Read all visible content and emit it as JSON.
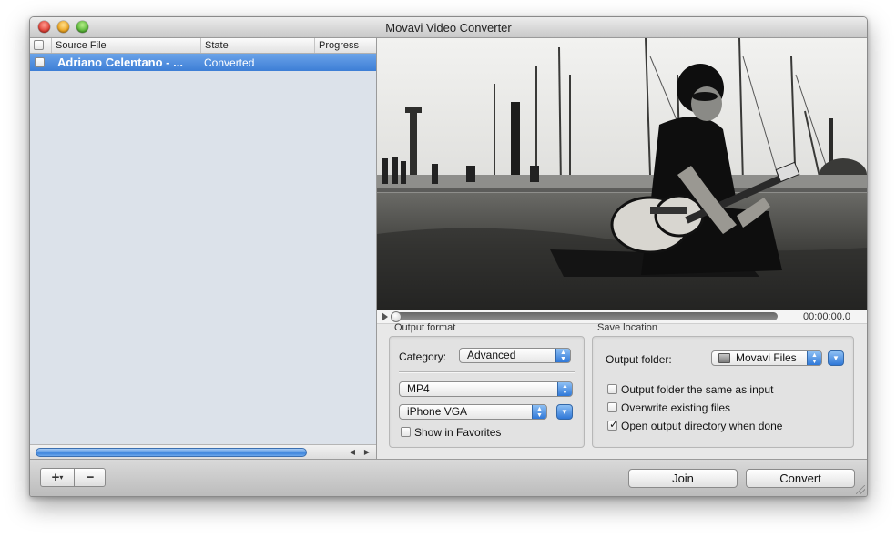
{
  "window": {
    "title": "Movavi Video Converter"
  },
  "file_list": {
    "columns": [
      "Source File",
      "State",
      "Progress"
    ],
    "rows": [
      {
        "source": "Adriano Celentano - ...",
        "state": "Converted",
        "progress": "",
        "selected": true,
        "checked": false
      }
    ]
  },
  "player": {
    "time": "00:00:00.0",
    "position": 0.0
  },
  "output_format": {
    "group_label": "Output format",
    "category_label": "Category:",
    "category_value": "Advanced",
    "format_value": "MP4",
    "preset_value": "iPhone VGA",
    "show_in_favorites_label": "Show in Favorites",
    "show_in_favorites_checked": false
  },
  "save_location": {
    "group_label": "Save location",
    "output_folder_label": "Output folder:",
    "output_folder_value": "Movavi Files",
    "options": [
      {
        "label": "Output folder the same as input",
        "checked": false
      },
      {
        "label": "Overwrite existing files",
        "checked": false
      },
      {
        "label": "Open output directory when done",
        "checked": true
      }
    ]
  },
  "bottom_bar": {
    "add_label": "+",
    "remove_label": "−",
    "join_label": "Join",
    "convert_label": "Convert"
  },
  "colors": {
    "selection": "#3d7ed6",
    "accent_blue": "#2f78d8"
  },
  "icons": [
    "close-light",
    "minimize-light",
    "zoom-light",
    "play-icon",
    "folder-icon",
    "dropdown-arrow-icon"
  ]
}
